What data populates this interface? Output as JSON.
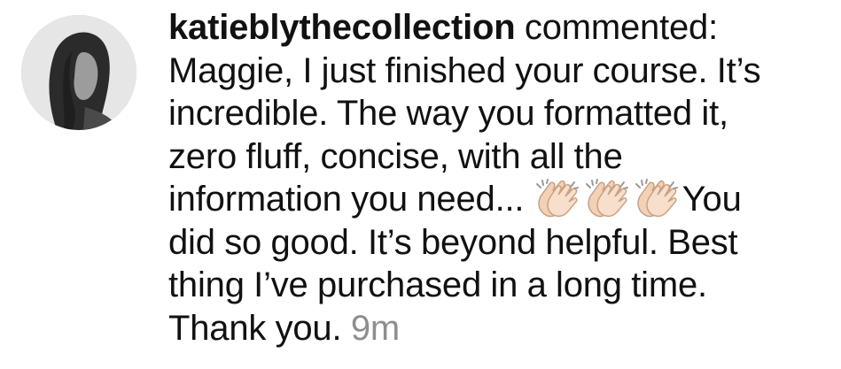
{
  "comment": {
    "username": "katieblythecollection",
    "action": "commented:",
    "lines": [
      "Maggie, I just finished your course. It’s",
      "incredible. The way you formatted it,",
      "zero fluff, concise, with all the",
      "information you need..."
    ],
    "after_emoji": "You",
    "lines_after": [
      "did so good. It’s beyond helpful. Best",
      "thing I’ve purchased in a long time."
    ],
    "last_line": "Thank you.",
    "timestamp": "9m",
    "emoji": [
      "clapping-hands",
      "clapping-hands",
      "clapping-hands"
    ]
  },
  "colors": {
    "text": "#111111",
    "timestamp": "#8e8e8e",
    "emoji_skin": "#f2d1b6"
  }
}
